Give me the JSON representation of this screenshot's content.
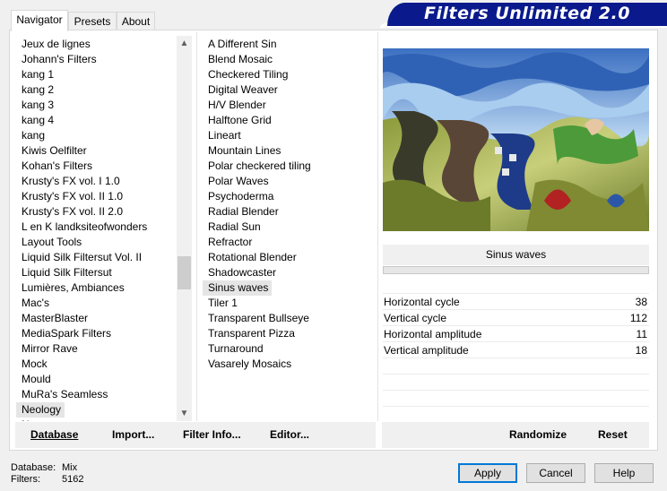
{
  "banner": {
    "title": "Filters Unlimited 2.0"
  },
  "tabs": [
    {
      "label": "Navigator",
      "active": true
    },
    {
      "label": "Presets",
      "active": false
    },
    {
      "label": "About",
      "active": false
    }
  ],
  "categories": {
    "items": [
      "Jeux de lignes",
      "Johann's Filters",
      "kang 1",
      "kang 2",
      "kang 3",
      "kang 4",
      "kang",
      "Kiwis Oelfilter",
      "Kohan's Filters",
      "Krusty's FX vol. I 1.0",
      "Krusty's FX vol. II 1.0",
      "Krusty's FX vol. II 2.0",
      "L en K landksiteofwonders",
      "Layout Tools",
      "Liquid Silk Filtersut Vol. II",
      "Liquid Silk Filtersut",
      "Lumières, Ambiances",
      "Mac's",
      "MasterBlaster",
      "MediaSpark Filters",
      "Mirror Rave",
      "Mock",
      "Mould",
      "MuRa's Seamless",
      "Neology",
      "Nes"
    ],
    "selected": "Neology"
  },
  "filters": {
    "items": [
      "A Different Sin",
      "Blend Mosaic",
      "Checkered Tiling",
      "Digital Weaver",
      "H/V Blender",
      "Halftone Grid",
      "Lineart",
      "Mountain Lines",
      "Polar checkered tiling",
      "Polar Waves",
      "Psychoderma",
      "Radial Blender",
      "Radial Sun",
      "Refractor",
      "Rotational Blender",
      "Shadowcaster",
      "Sinus waves",
      "Tiler 1",
      "Transparent Bullseye",
      "Transparent Pizza",
      "Turnaround",
      "Vasarely Mosaics"
    ],
    "selected": "Sinus waves"
  },
  "preview": {
    "filter_name": "Sinus waves"
  },
  "params": [
    {
      "label": "Horizontal cycle",
      "value": "38"
    },
    {
      "label": "Vertical cycle",
      "value": "112"
    },
    {
      "label": "Horizontal amplitude",
      "value": "11"
    },
    {
      "label": "Vertical amplitude",
      "value": "18"
    }
  ],
  "actions": {
    "database": "Database",
    "import": "Import...",
    "filter_info": "Filter Info...",
    "editor": "Editor...",
    "randomize": "Randomize",
    "reset": "Reset"
  },
  "status": {
    "database_label": "Database:",
    "database_value": "Mix",
    "filters_label": "Filters:",
    "filters_value": "5162"
  },
  "buttons": {
    "apply": "Apply",
    "cancel": "Cancel",
    "help": "Help"
  },
  "colors": {
    "banner": "#0a1a8c",
    "default_button_border": "#0078d7",
    "selection": "#e5e5e5"
  }
}
